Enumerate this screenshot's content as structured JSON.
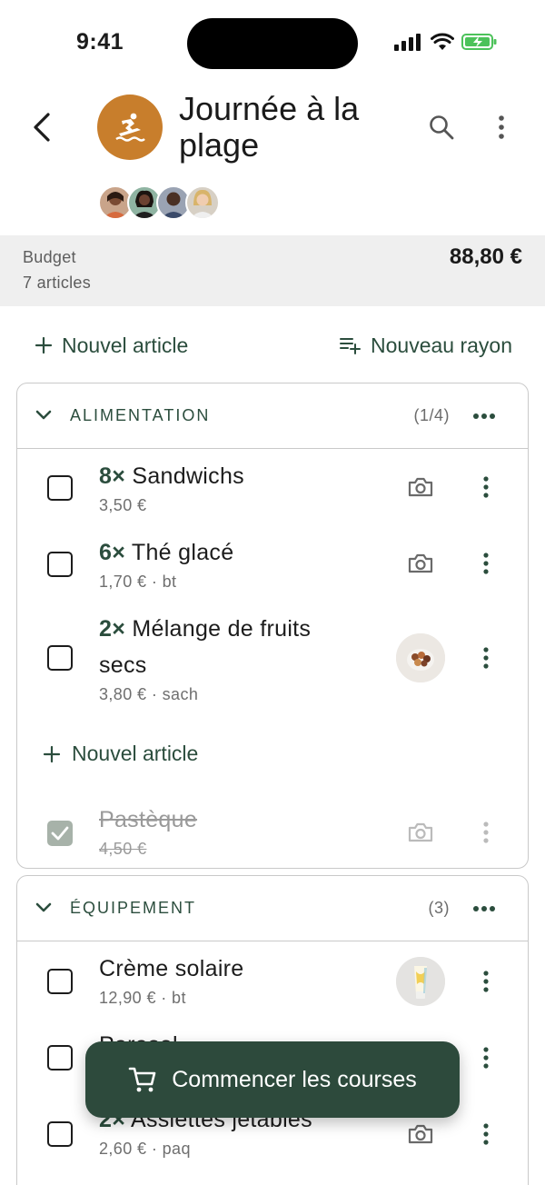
{
  "status_bar": {
    "time": "9:41"
  },
  "header": {
    "title": "Journée à la plage",
    "members": [
      "member-1",
      "member-2",
      "member-3",
      "member-4"
    ]
  },
  "budget": {
    "label": "Budget",
    "articles": "7 articles",
    "amount": "88,80 €"
  },
  "actions": {
    "new_article": "Nouvel article",
    "new_section": "Nouveau rayon"
  },
  "sections": [
    {
      "name": "ALIMENTATION",
      "count": "(1/4)",
      "items": [
        {
          "qty": "8×",
          "name": "Sandwichs",
          "price": "3,50 €",
          "checked": false,
          "media": "camera-icon"
        },
        {
          "qty": "6×",
          "name": "Thé glacé",
          "price": "1,70 € · bt",
          "checked": false,
          "media": "camera-icon"
        },
        {
          "qty": "2×",
          "name": "Mélange de fruits",
          "name2": "secs",
          "price": "3,80 € · sach",
          "checked": false,
          "media": "photo"
        },
        {
          "qty": "",
          "name": "Pastèque",
          "price": "4,50 €",
          "checked": true,
          "media": "camera-icon"
        }
      ],
      "add_label": "Nouvel article"
    },
    {
      "name": "ÉQUIPEMENT",
      "count": "(3)",
      "items": [
        {
          "qty": "",
          "name": "Crème solaire",
          "price": "12,90 € · bt",
          "checked": false,
          "media": "photo"
        },
        {
          "qty": "",
          "name": "Parasol",
          "price": "",
          "checked": false,
          "media": "none"
        },
        {
          "qty": "2×",
          "name": "Assiettes jetables",
          "price": "2,60 € · paq",
          "checked": false,
          "media": "camera-icon"
        }
      ]
    }
  ],
  "fab": {
    "label": "Commencer les courses"
  },
  "colors": {
    "accent": "#2d4a3c",
    "list_icon_bg": "#c87e2c",
    "budget_band": "#efefef"
  }
}
